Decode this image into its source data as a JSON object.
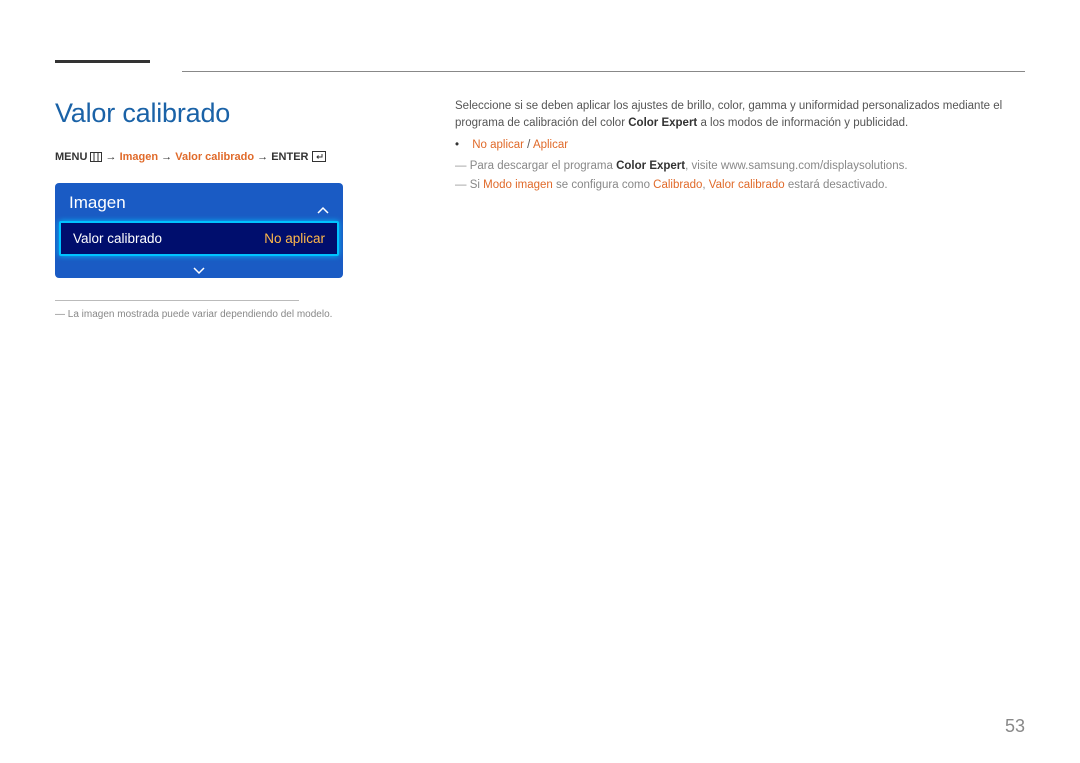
{
  "title": "Valor calibrado",
  "breadcrumb": {
    "menu_label": "MENU",
    "arrow": "→",
    "crumb1": "Imagen",
    "crumb2": "Valor calibrado",
    "enter_label": "ENTER"
  },
  "menu_panel": {
    "title": "Imagen",
    "item_label": "Valor calibrado",
    "item_value": "No aplicar"
  },
  "left_note": "—  La imagen mostrada puede variar dependiendo del modelo.",
  "right": {
    "para_a": "Seleccione si se deben aplicar los ajustes de brillo, color, gamma y uniformidad personalizados mediante el programa de calibración del color ",
    "para_b_strong": "Color Expert",
    "para_c": " a los modos de información y publicidad.",
    "opt_noapply": "No aplicar",
    "opt_sep": " / ",
    "opt_apply": "Aplicar",
    "note1_a": "Para descargar el programa ",
    "note1_b_strong": "Color Expert",
    "note1_c": ", visite www.samsung.com/displaysolutions.",
    "note2_a": "Si ",
    "note2_b": "Modo imagen",
    "note2_c": " se configura como ",
    "note2_d": "Calibrado",
    "note2_e": ", ",
    "note2_f": "Valor calibrado",
    "note2_g": " estará desactivado."
  },
  "page_number": "53"
}
